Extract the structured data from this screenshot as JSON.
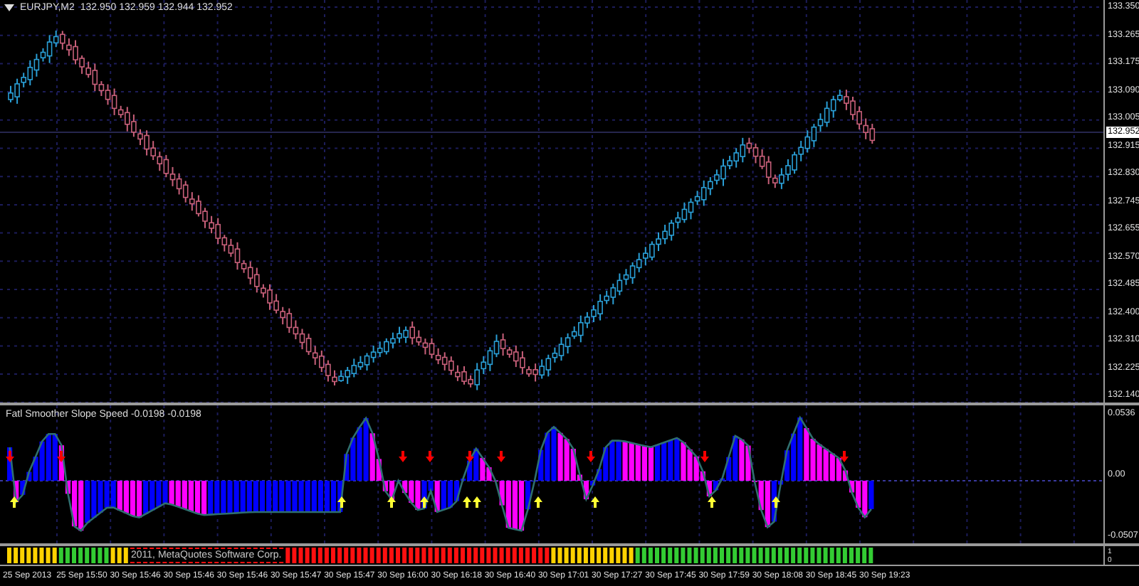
{
  "chart": {
    "symbol": "EURJPY,M2",
    "quote": "132.950 132.959 132.944 132.952",
    "price_labels": [
      "133.350",
      "133.265",
      "133.175",
      "133.090",
      "133.005",
      "132.915",
      "132.830",
      "132.745",
      "132.655",
      "132.570",
      "132.485",
      "132.400",
      "132.310",
      "132.225",
      "132.140"
    ],
    "current_price": "132.952"
  },
  "indicator": {
    "title": "Fatl Smoother Slope Speed -0.0198 -0.0198",
    "axis_labels": [
      "0.0536",
      "0.00",
      "-0.0507"
    ]
  },
  "signal_strip": {
    "overlay_text": "2011, MetaQuotes Software Corp.",
    "axis_labels": [
      "1",
      "0"
    ]
  },
  "time_axis": [
    "25 Sep 2013",
    "25 Sep 15:50",
    "30 Sep 15:46",
    "30 Sep 15:46",
    "30 Sep 15:46",
    "30 Sep 15:47",
    "30 Sep 15:47",
    "30 Sep 16:00",
    "30 Sep 16:18",
    "30 Sep 16:40",
    "30 Sep 17:01",
    "30 Sep 17:27",
    "30 Sep 17:45",
    "30 Sep 17:59",
    "30 Sep 18:08",
    "30 Sep 18:45",
    "30 Sep 19:23"
  ]
}
